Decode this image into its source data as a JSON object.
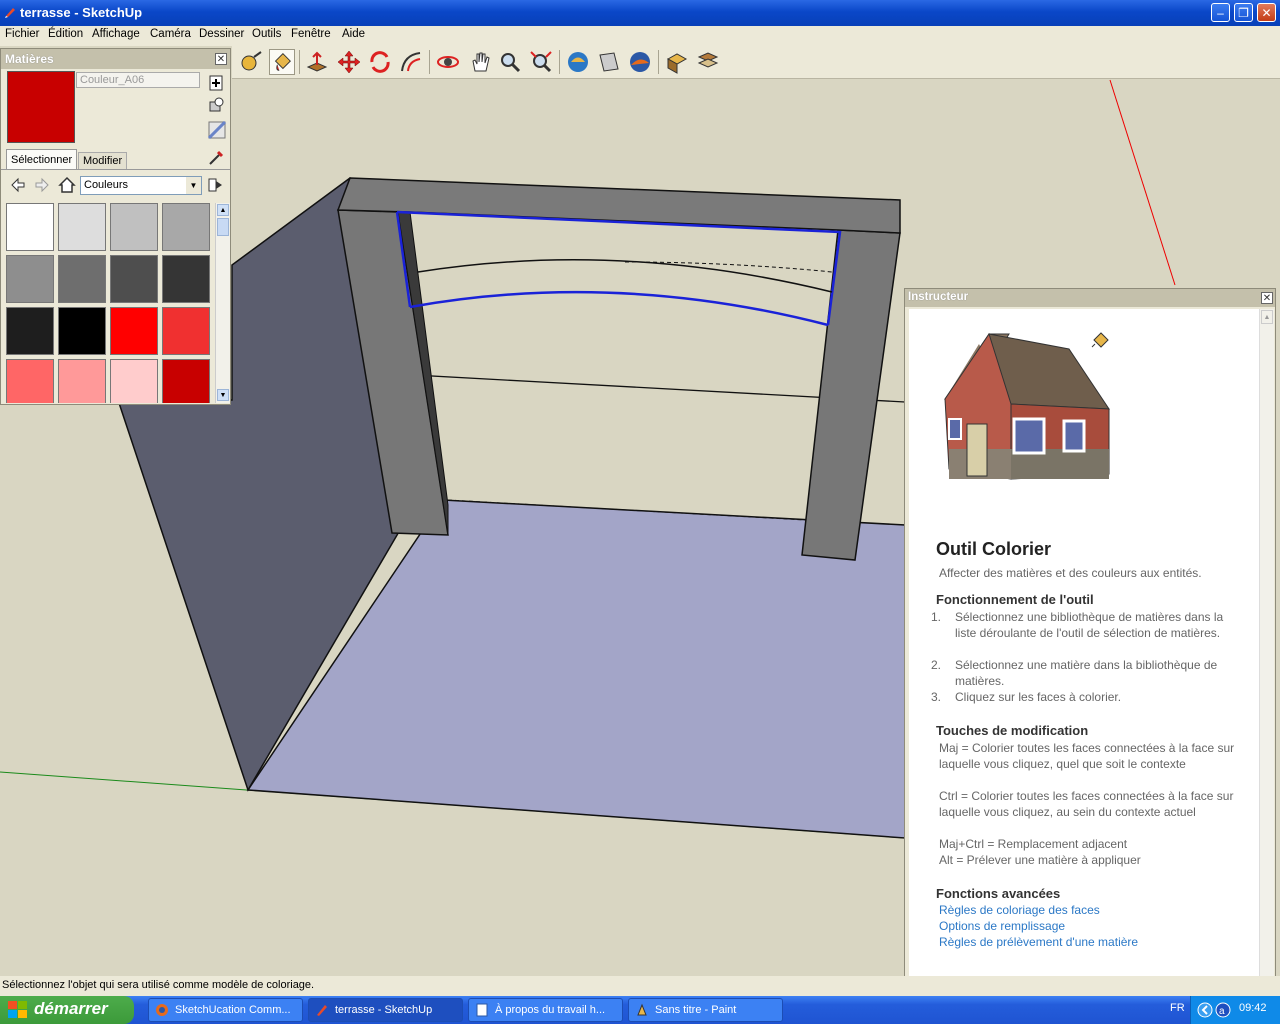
{
  "window": {
    "title": "terrasse - SketchUp",
    "min": "–",
    "max": "❐",
    "close": "✕"
  },
  "menu": [
    "Fichier",
    "Édition",
    "Affichage",
    "Caméra",
    "Dessiner",
    "Outils",
    "Fenêtre",
    "Aide"
  ],
  "materials": {
    "title": "Matières",
    "current_name": "Couleur_A06",
    "current_color": "#c80000",
    "tab_select": "Sélectionner",
    "tab_edit": "Modifier",
    "library": "Couleurs",
    "swatches": [
      "#ffffff",
      "#dddddd",
      "#c0c0c0",
      "#a8a8a8",
      "#8e8e8e",
      "#6e6e6e",
      "#4e4e4e",
      "#353535",
      "#1e1e1e",
      "#000000",
      "#ff0000",
      "#f03030",
      "#ff6666",
      "#ff9999",
      "#ffcccc",
      "#c80000"
    ]
  },
  "instructor": {
    "title": "Instructeur",
    "tool_name": "Outil Colorier",
    "subtitle": "Affecter des matières et des couleurs aux entités.",
    "op_heading": "Fonctionnement de l'outil",
    "steps": [
      {
        "n": "1.",
        "text": "Sélectionnez une bibliothèque de matières dans la liste déroulante de l'outil de sélection de matières."
      },
      {
        "n": "2.",
        "text": "Sélectionnez une matière dans la bibliothèque de matières."
      },
      {
        "n": "3.",
        "text": "Cliquez sur les faces à colorier."
      }
    ],
    "mod_heading": "Touches de modification",
    "mods": [
      "Maj = Colorier toutes les faces connectées à la face sur laquelle vous cliquez, quel que soit le contexte",
      "Ctrl = Colorier toutes les faces connectées à la face sur laquelle vous cliquez, au sein du contexte actuel",
      "Maj+Ctrl = Remplacement adjacent",
      "Alt = Prélever une matière à appliquer"
    ],
    "adv_heading": "Fonctions avancées",
    "links": [
      "Règles de coloriage des faces",
      "Options de remplissage",
      "Règles de prélèvement d'une matière"
    ]
  },
  "status": "Sélectionnez l'objet qui sera utilisé comme modèle de coloriage.",
  "taskbar": {
    "start": "démarrer",
    "tasks": [
      "SketchUcation Comm...",
      "terrasse - SketchUp",
      "À propos du travail h...",
      "Sans titre - Paint"
    ],
    "lang": "FR",
    "time": "09:42"
  }
}
